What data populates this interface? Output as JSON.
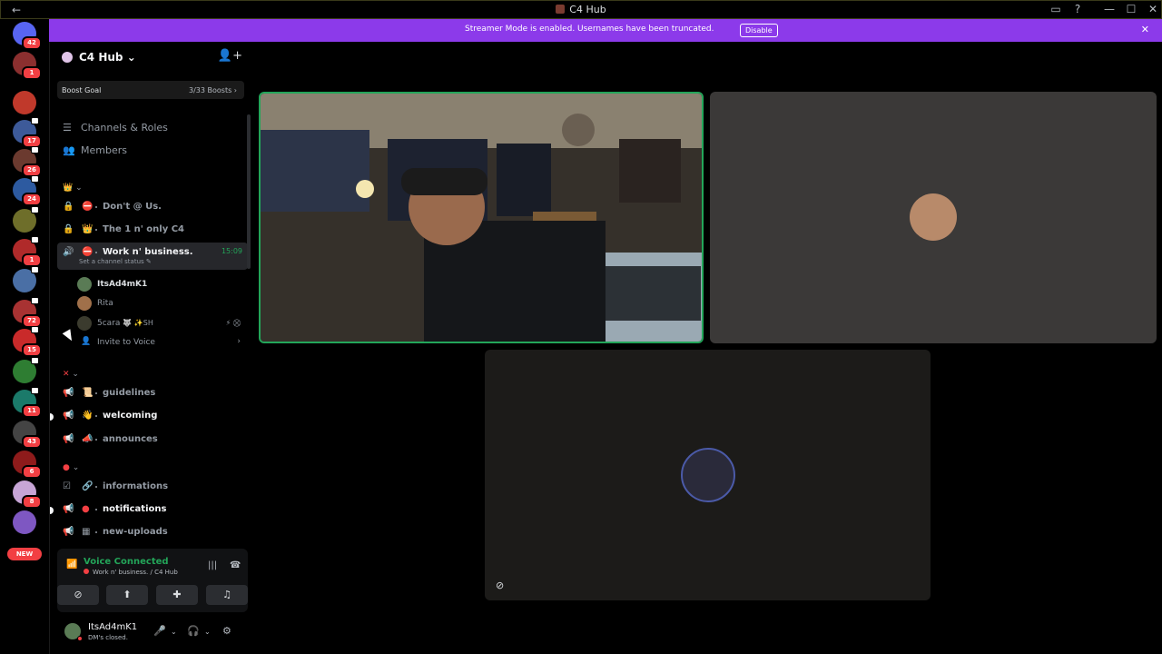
{
  "window": {
    "title": "C4 Hub",
    "back_glyph": "←",
    "controls": {
      "inbox": "▭",
      "help": "?",
      "minimize": "—",
      "maximize": "☐",
      "close": "✕"
    }
  },
  "banner": {
    "message": "Streamer Mode is enabled. Usernames have been truncated.",
    "disable_label": "Disable",
    "close_glyph": "✕",
    "color": "#8c3aea"
  },
  "rail": {
    "servers": [
      {
        "icon": "discord-home-icon",
        "badge": "42",
        "color": "#5865f2"
      },
      {
        "icon": "server-icon",
        "badge": "1",
        "color": "#8b2f2f"
      },
      {
        "icon": "mafia-server-icon",
        "badge": "",
        "color": "#c0392b"
      },
      {
        "icon": "server-icon",
        "badge": "17",
        "color": "#3d5a99"
      },
      {
        "icon": "server-icon",
        "badge": "26",
        "color": "#6b3a2f"
      },
      {
        "icon": "server-icon",
        "badge": "24",
        "color": "#2d5aa0"
      },
      {
        "icon": "server-icon",
        "badge": "",
        "color": "#6e6e2a"
      },
      {
        "icon": "server-icon",
        "badge": "1",
        "color": "#b02a2a"
      },
      {
        "icon": "server-icon",
        "badge": "",
        "color": "#4a6fa5"
      },
      {
        "icon": "server-icon",
        "badge": "72",
        "color": "#a83232"
      },
      {
        "icon": "server-icon",
        "badge": "15",
        "color": "#c92a2a"
      },
      {
        "icon": "server-icon",
        "badge": "",
        "color": "#2e7d32"
      },
      {
        "icon": "server-icon",
        "badge": "11",
        "color": "#1b7a6a"
      },
      {
        "icon": "server-icon",
        "badge": "43",
        "color": "#444444"
      },
      {
        "icon": "server-icon",
        "badge": "6",
        "color": "#8e1b1b"
      },
      {
        "icon": "server-icon",
        "badge": "8",
        "color": "#c7a5d6"
      },
      {
        "icon": "server-icon",
        "badge": "",
        "color": "#7e57c2"
      }
    ],
    "new_label": "NEW"
  },
  "server": {
    "name": "C4 Hub",
    "caret": "⌄",
    "boost_label": "Boost Goal",
    "boost_value": "3/33 Boosts",
    "boost_arrow": "›",
    "nav": [
      {
        "label": "Channels & Roles",
        "icon": "list-icon"
      },
      {
        "label": "Members",
        "icon": "members-icon"
      }
    ]
  },
  "categories": {
    "first_glyph": "👑",
    "second_glyph": "✕",
    "third_glyph": "●",
    "caret": "⌄"
  },
  "channels": {
    "voice_locked": [
      {
        "name": "Don't @ Us.",
        "emoji": "⛔"
      },
      {
        "name": "The 1 n' only C4",
        "emoji": "👑"
      }
    ],
    "active": {
      "name": "Work n' business.",
      "emoji": "⛔",
      "time": "15:09",
      "status": "Set a channel status ✎"
    },
    "voice_users": [
      {
        "name": "ItsAd4mK1",
        "color": "#5a7b55",
        "dim": false
      },
      {
        "name": "Rita",
        "color": "#a0704a",
        "dim": true
      },
      {
        "name": "5cara",
        "suffix": "🐺 ✨SH",
        "color": "#3b3b2e",
        "dim": true,
        "status_icons": "⚡ ⛒"
      }
    ],
    "invite": {
      "label": "Invite to Voice",
      "arrow": "›"
    },
    "text_cat2": [
      {
        "name": "guidelines",
        "emoji": "📜",
        "unread": false
      },
      {
        "name": "welcoming",
        "emoji": "👋",
        "unread": true
      },
      {
        "name": "announces",
        "emoji": "📣",
        "unread": false
      }
    ],
    "text_cat3": [
      {
        "name": "informations",
        "emoji": "🔗",
        "unread": false
      },
      {
        "name": "notifications",
        "emoji": "●",
        "unread": true
      },
      {
        "name": "new-uploads",
        "emoji": "▦",
        "unread": false
      }
    ]
  },
  "voice_panel": {
    "title": "Voice Connected",
    "subtitle": "Work n' business. / C4 Hub",
    "actions": [
      {
        "name": "camera-off-icon",
        "glyph": "⊘"
      },
      {
        "name": "screen-share-icon",
        "glyph": "⬆"
      },
      {
        "name": "activities-icon",
        "glyph": "✚"
      },
      {
        "name": "soundboard-icon",
        "glyph": "♫"
      }
    ]
  },
  "user": {
    "name": "ItsAd4mK1",
    "status": "DM's closed.",
    "mic_glyph": "🎤",
    "headset_glyph": "🎧",
    "settings_glyph": "⚙"
  }
}
